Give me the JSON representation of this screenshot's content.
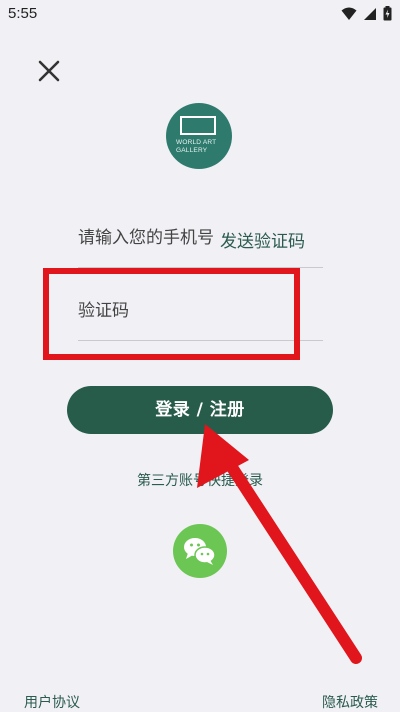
{
  "status_bar": {
    "time": "5:55",
    "icons": [
      "wifi-icon",
      "signal-icon",
      "battery-charging-icon"
    ]
  },
  "header": {
    "close_icon": "close-icon"
  },
  "logo": {
    "line1": "WORLD ART",
    "line2": "GALLERY"
  },
  "form": {
    "phone_placeholder": "请输入您的手机号",
    "send_code_label": "发送验证码",
    "code_placeholder": "验证码"
  },
  "login_button_label": "登录 / 注册",
  "third_party_label": "第三方账号快捷登录",
  "third_party_icon": "wechat-icon",
  "footer": {
    "user_agreement": "用户协议",
    "privacy_policy": "隐私政策"
  },
  "colors": {
    "background": "#f1f0f5",
    "primary": "#285c4a",
    "wechat": "#6cc654",
    "annotation": "#e0161c"
  }
}
